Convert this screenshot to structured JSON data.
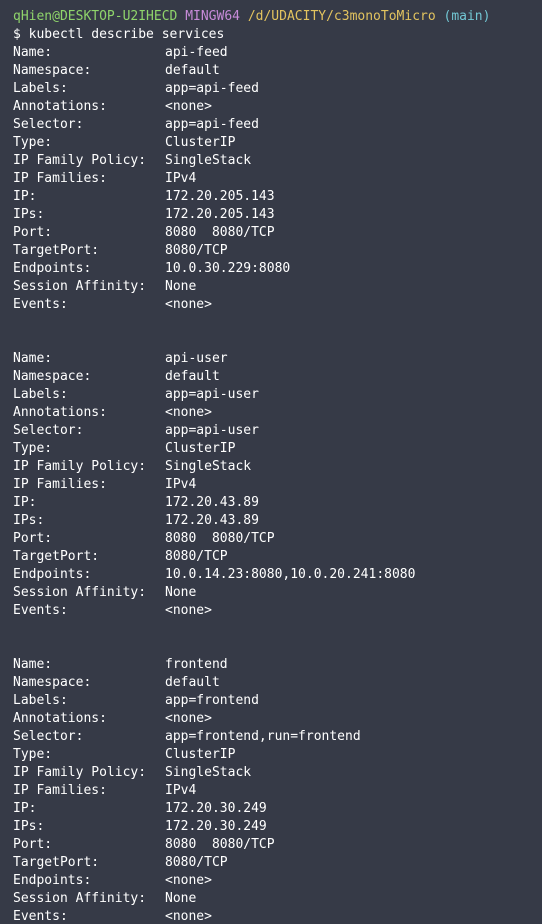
{
  "prompt": {
    "user_host": "qHien@DESKTOP-U2IHECD",
    "shell": "MINGW64",
    "path": "/d/UDACITY/c3monoToMicro",
    "branch": "(main)",
    "command_symbol": "$",
    "command": "kubectl describe services"
  },
  "colors": {
    "background": "#363a47",
    "text": "#ffffff",
    "user_host": "#8fd46b",
    "shell": "#c78bd9",
    "path": "#e2c35f",
    "branch": "#72c7d4"
  },
  "services": [
    {
      "fields": [
        {
          "key": "Name:",
          "value": "api-feed"
        },
        {
          "key": "Namespace:",
          "value": "default"
        },
        {
          "key": "Labels:",
          "value": "app=api-feed"
        },
        {
          "key": "Annotations:",
          "value": "<none>"
        },
        {
          "key": "Selector:",
          "value": "app=api-feed"
        },
        {
          "key": "Type:",
          "value": "ClusterIP"
        },
        {
          "key": "IP Family Policy:",
          "value": "SingleStack"
        },
        {
          "key": "IP Families:",
          "value": "IPv4"
        },
        {
          "key": "IP:",
          "value": "172.20.205.143"
        },
        {
          "key": "IPs:",
          "value": "172.20.205.143"
        },
        {
          "key": "Port:",
          "value": "8080  8080/TCP"
        },
        {
          "key": "TargetPort:",
          "value": "8080/TCP"
        },
        {
          "key": "Endpoints:",
          "value": "10.0.30.229:8080"
        },
        {
          "key": "Session Affinity:",
          "value": "None"
        },
        {
          "key": "Events:",
          "value": "<none>"
        }
      ]
    },
    {
      "fields": [
        {
          "key": "Name:",
          "value": "api-user"
        },
        {
          "key": "Namespace:",
          "value": "default"
        },
        {
          "key": "Labels:",
          "value": "app=api-user"
        },
        {
          "key": "Annotations:",
          "value": "<none>"
        },
        {
          "key": "Selector:",
          "value": "app=api-user"
        },
        {
          "key": "Type:",
          "value": "ClusterIP"
        },
        {
          "key": "IP Family Policy:",
          "value": "SingleStack"
        },
        {
          "key": "IP Families:",
          "value": "IPv4"
        },
        {
          "key": "IP:",
          "value": "172.20.43.89"
        },
        {
          "key": "IPs:",
          "value": "172.20.43.89"
        },
        {
          "key": "Port:",
          "value": "8080  8080/TCP"
        },
        {
          "key": "TargetPort:",
          "value": "8080/TCP"
        },
        {
          "key": "Endpoints:",
          "value": "10.0.14.23:8080,10.0.20.241:8080"
        },
        {
          "key": "Session Affinity:",
          "value": "None"
        },
        {
          "key": "Events:",
          "value": "<none>"
        }
      ]
    },
    {
      "fields": [
        {
          "key": "Name:",
          "value": "frontend"
        },
        {
          "key": "Namespace:",
          "value": "default"
        },
        {
          "key": "Labels:",
          "value": "app=frontend"
        },
        {
          "key": "Annotations:",
          "value": "<none>"
        },
        {
          "key": "Selector:",
          "value": "app=frontend,run=frontend"
        },
        {
          "key": "Type:",
          "value": "ClusterIP"
        },
        {
          "key": "IP Family Policy:",
          "value": "SingleStack"
        },
        {
          "key": "IP Families:",
          "value": "IPv4"
        },
        {
          "key": "IP:",
          "value": "172.20.30.249"
        },
        {
          "key": "IPs:",
          "value": "172.20.30.249"
        },
        {
          "key": "Port:",
          "value": "8080  8080/TCP"
        },
        {
          "key": "TargetPort:",
          "value": "8080/TCP"
        },
        {
          "key": "Endpoints:",
          "value": "<none>"
        },
        {
          "key": "Session Affinity:",
          "value": "None"
        },
        {
          "key": "Events:",
          "value": "<none>"
        }
      ]
    }
  ]
}
